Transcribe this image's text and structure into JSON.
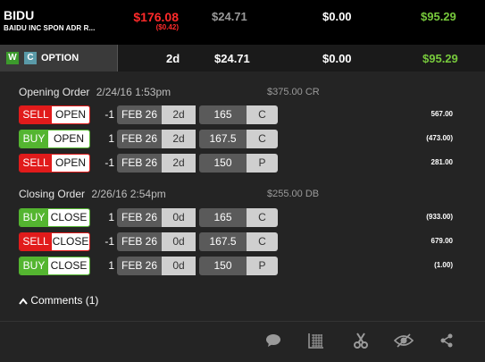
{
  "header": {
    "symbol": "BIDU",
    "description": "BAIDU INC SPON ADR R...",
    "price": "$176.08",
    "change": "($0.42)",
    "cost": "$24.71",
    "mid": "$0.00",
    "pnl": "$95.29"
  },
  "strip": {
    "badge_w": "W",
    "badge_c": "C",
    "label": "OPTION",
    "days": "2d",
    "cost": "$24.71",
    "mid": "$0.00",
    "pnl": "$95.29"
  },
  "opening": {
    "title": "Opening Order",
    "timestamp": "2/24/16 1:53pm",
    "amount": "$375.00 CR",
    "legs": [
      {
        "side": "SELL",
        "action": "OPEN",
        "qty": "-1",
        "exp": "FEB 26",
        "dte": "2d",
        "strike": "165",
        "type": "C",
        "value": "567.00"
      },
      {
        "side": "BUY",
        "action": "OPEN",
        "qty": "1",
        "exp": "FEB 26",
        "dte": "2d",
        "strike": "167.5",
        "type": "C",
        "value": "(473.00)"
      },
      {
        "side": "SELL",
        "action": "OPEN",
        "qty": "-1",
        "exp": "FEB 26",
        "dte": "2d",
        "strike": "150",
        "type": "P",
        "value": "281.00"
      }
    ]
  },
  "closing": {
    "title": "Closing Order",
    "timestamp": "2/26/16 2:54pm",
    "amount": "$255.00 DB",
    "legs": [
      {
        "side": "BUY",
        "action": "CLOSE",
        "qty": "1",
        "exp": "FEB 26",
        "dte": "0d",
        "strike": "165",
        "type": "C",
        "value": "(933.00)"
      },
      {
        "side": "SELL",
        "action": "CLOSE",
        "qty": "-1",
        "exp": "FEB 26",
        "dte": "0d",
        "strike": "167.5",
        "type": "C",
        "value": "679.00"
      },
      {
        "side": "BUY",
        "action": "CLOSE",
        "qty": "1",
        "exp": "FEB 26",
        "dte": "0d",
        "strike": "150",
        "type": "P",
        "value": "(1.00)"
      }
    ]
  },
  "comments": {
    "label": "Comments (1)",
    "icon": "chevron-up-icon"
  },
  "toolbar": [
    {
      "icon": "comment-icon"
    },
    {
      "icon": "chart-icon"
    },
    {
      "icon": "scissors-icon"
    },
    {
      "icon": "hide-eye-icon"
    },
    {
      "icon": "share-icon"
    }
  ],
  "colors": {
    "sell": "#e11b1b",
    "buy": "#54b530",
    "price_down": "#ff2a2a",
    "pnl": "#77c93c"
  }
}
